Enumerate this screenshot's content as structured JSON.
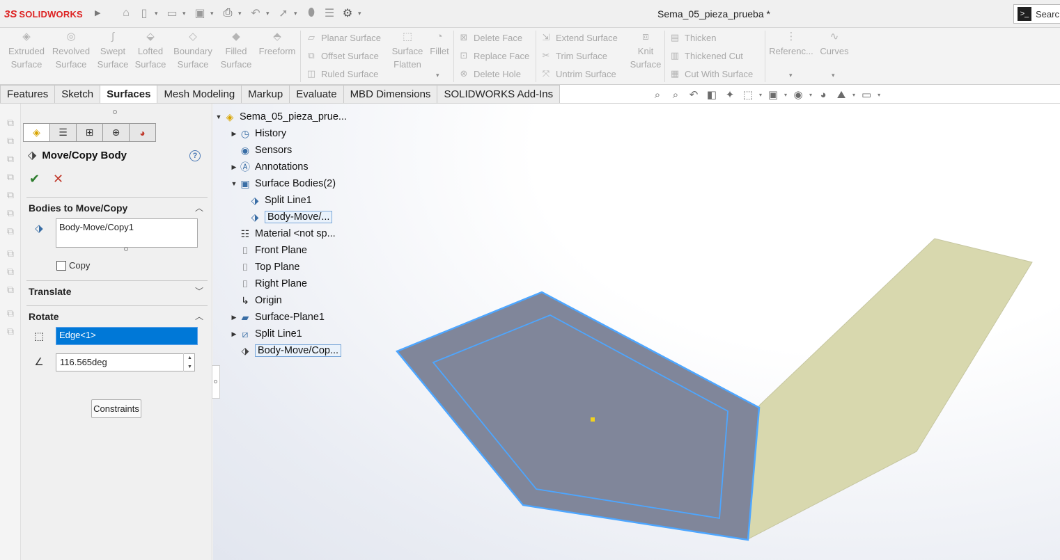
{
  "app": {
    "brand_mark": "3S",
    "brand_name": "SOLIDWORKS",
    "document_title": "Sema_05_pieza_prueba *",
    "search_label": "Searc"
  },
  "ribbon": {
    "extruded": [
      "Extruded",
      "Surface"
    ],
    "revolved": [
      "Revolved",
      "Surface"
    ],
    "swept": [
      "Swept",
      "Surface"
    ],
    "lofted": [
      "Lofted",
      "Surface"
    ],
    "boundary": [
      "Boundary",
      "Surface"
    ],
    "filled": [
      "Filled",
      "Surface"
    ],
    "freeform": "Freeform",
    "planar": "Planar Surface",
    "offset": "Offset Surface",
    "ruled": "Ruled Surface",
    "flatten": [
      "Surface",
      "Flatten"
    ],
    "fillet": "Fillet",
    "delete_face": "Delete Face",
    "replace_face": "Replace Face",
    "delete_hole": "Delete Hole",
    "extend": "Extend Surface",
    "trim": "Trim Surface",
    "untrim": "Untrim Surface",
    "knit": [
      "Knit",
      "Surface"
    ],
    "thicken": "Thicken",
    "thickened_cut": "Thickened Cut",
    "cut_with_surface": "Cut With Surface",
    "reference": "Referenc...",
    "curves": "Curves"
  },
  "tabs": [
    "Features",
    "Sketch",
    "Surfaces",
    "Mesh Modeling",
    "Markup",
    "Evaluate",
    "MBD Dimensions",
    "SOLIDWORKS Add-Ins"
  ],
  "active_tab": "Surfaces",
  "property_manager": {
    "title": "Move/Copy Body",
    "help": "?",
    "ok": "✔",
    "cancel": "✕",
    "section_bodies": "Bodies to Move/Copy",
    "body_item": "Body-Move/Copy1",
    "copy_label": "Copy",
    "section_translate": "Translate",
    "section_rotate": "Rotate",
    "rotate_edge": "Edge<1>",
    "rotate_angle": "116.565deg",
    "constraints_button": "Constraints"
  },
  "tree": {
    "root": "Sema_05_pieza_prue...",
    "history": "History",
    "sensors": "Sensors",
    "annotations": "Annotations",
    "surface_bodies": "Surface Bodies(2)",
    "split_line_body": "Split Line1",
    "body_move_child": "Body-Move/...",
    "material": "Material <not sp...",
    "front_plane": "Front Plane",
    "top_plane": "Top Plane",
    "right_plane": "Right Plane",
    "origin": "Origin",
    "surface_plane": "Surface-Plane1",
    "split_line": "Split Line1",
    "body_move_feature": "Body-Move/Cop..."
  },
  "colors": {
    "accent": "#0078d7",
    "body_face": "#80869a",
    "edge_highlight": "#4da6ff",
    "other_surface": "#d8d8ae",
    "ok": "#2c7c2c",
    "cancel": "#c0392b"
  }
}
